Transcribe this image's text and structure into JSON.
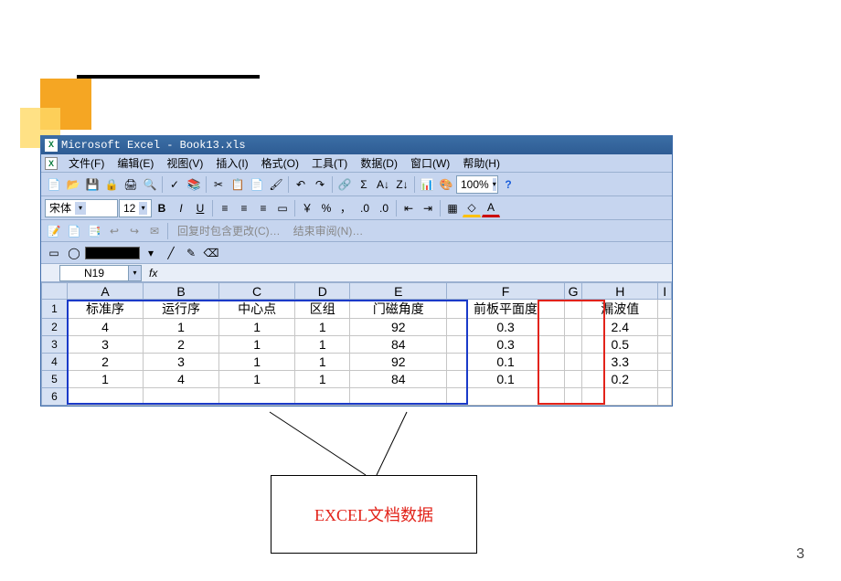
{
  "title": "Microsoft Excel - Book13.xls",
  "menu": [
    "文件(F)",
    "编辑(E)",
    "视图(V)",
    "插入(I)",
    "格式(O)",
    "工具(T)",
    "数据(D)",
    "窗口(W)",
    "帮助(H)"
  ],
  "font_name": "宋体",
  "font_size": "12",
  "zoom": "100%",
  "review_text1": "回复时包含更改(C)…",
  "review_text2": "结束审阅(N)…",
  "cell_ref": "N19",
  "fx": "fx",
  "columns": [
    "A",
    "B",
    "C",
    "D",
    "E",
    "F",
    "G",
    "H",
    "I"
  ],
  "headers": {
    "A": "标准序",
    "B": "运行序",
    "C": "中心点",
    "D": "区组",
    "E": "门磁角度",
    "F": "前板平面度",
    "H": "漏波值"
  },
  "rows": [
    {
      "n": 1,
      "A": "标准序",
      "B": "运行序",
      "C": "中心点",
      "D": "区组",
      "E": "门磁角度",
      "F": "前板平面度",
      "G": "",
      "H": "漏波值",
      "I": ""
    },
    {
      "n": 2,
      "A": "4",
      "B": "1",
      "C": "1",
      "D": "1",
      "E": "92",
      "F": "0.3",
      "G": "",
      "H": "2.4",
      "I": ""
    },
    {
      "n": 3,
      "A": "3",
      "B": "2",
      "C": "1",
      "D": "1",
      "E": "84",
      "F": "0.3",
      "G": "",
      "H": "0.5",
      "I": ""
    },
    {
      "n": 4,
      "A": "2",
      "B": "3",
      "C": "1",
      "D": "1",
      "E": "92",
      "F": "0.1",
      "G": "",
      "H": "3.3",
      "I": ""
    },
    {
      "n": 5,
      "A": "1",
      "B": "4",
      "C": "1",
      "D": "1",
      "E": "84",
      "F": "0.1",
      "G": "",
      "H": "0.2",
      "I": ""
    },
    {
      "n": 6,
      "A": "",
      "B": "",
      "C": "",
      "D": "",
      "E": "",
      "F": "",
      "G": "",
      "H": "",
      "I": ""
    }
  ],
  "callout": "EXCEL文档数据",
  "page": "3"
}
